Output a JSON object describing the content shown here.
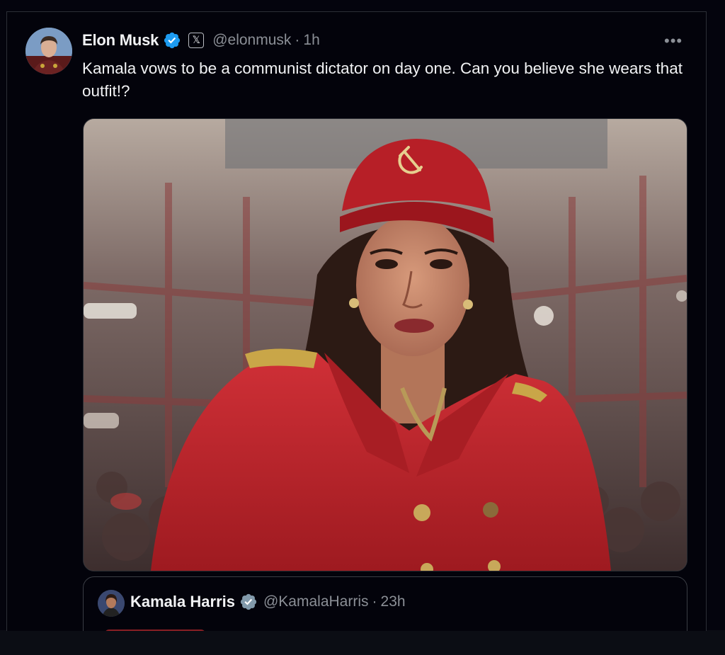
{
  "tweet": {
    "author_name": "Elon Musk",
    "author_handle": "@elonmusk",
    "separator": "·",
    "time": "1h",
    "more_label": "•••",
    "text": "Kamala vows to be a communist dictator on day one. Can you believe she wears that outfit!?",
    "x_badge": "𝕏",
    "icons": {
      "verified": "verified-badge-icon",
      "affiliate": "x-logo-icon",
      "more": "more-options-icon"
    }
  },
  "media": {
    "description_icon": "image",
    "colors": {
      "coat": "#c4262b",
      "hat": "#b71f27",
      "background": "#6a5a58"
    }
  },
  "quote": {
    "author_name": "Kamala Harris",
    "author_handle": "@KamalaHarris",
    "separator": "·",
    "time": "23h"
  },
  "colors": {
    "background": "#03030b",
    "text": "#f2f3f5",
    "muted": "#8b8f96",
    "verified_blue": "#1d9bf0",
    "border": "#2c2f36"
  }
}
